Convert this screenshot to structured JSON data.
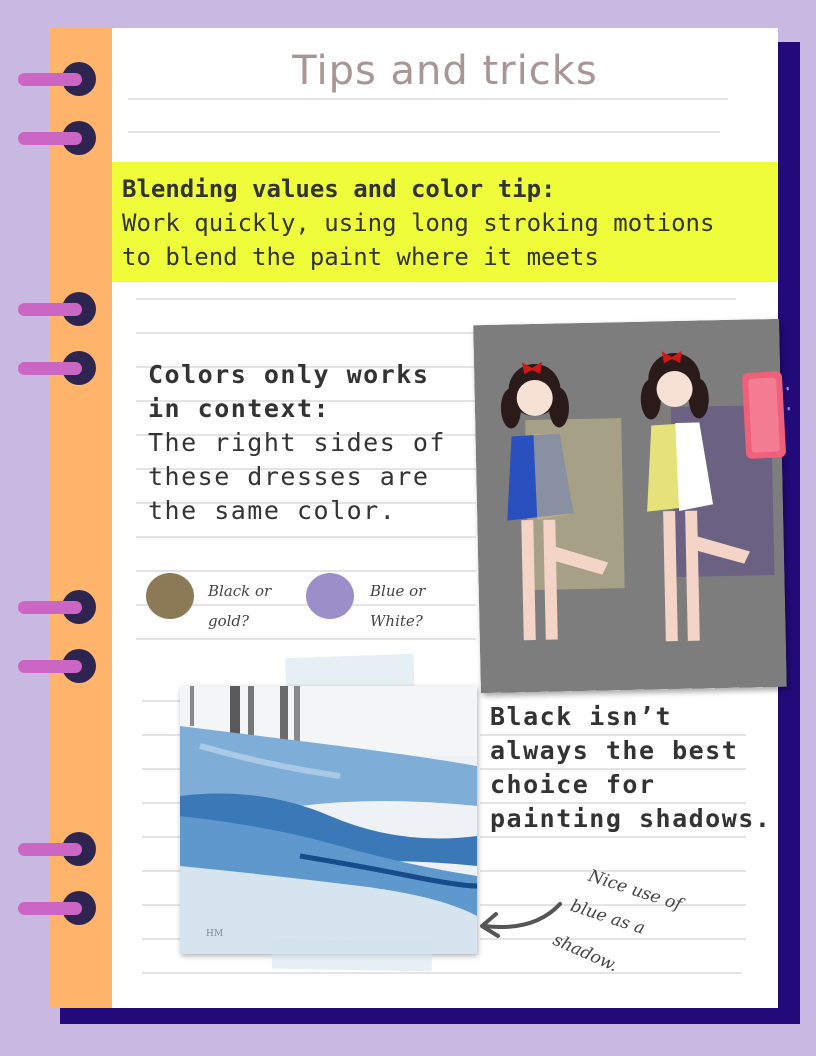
{
  "colors": {
    "background": "#c9b8e2",
    "back_page": "#230a7a",
    "spine": "#ffb46b",
    "ring_bar": "#cc66c4",
    "ring_hole": "#2e2450",
    "title": "#a89595",
    "highlight": "#eefc3a",
    "rule": "#e4e4e8",
    "swatch_gold": "#8c7955",
    "swatch_blue": "#9b8fca",
    "clip": "#f0607a",
    "text": "#333333"
  },
  "page": {
    "title": "Tips and tricks"
  },
  "tip": {
    "heading": "Blending values and color tip:",
    "line1": "Work quickly, using long stroking motions",
    "line2": "to blend the paint where it meets"
  },
  "context": {
    "heading_line1": "Colors only works",
    "heading_line2": "in context:",
    "body_line1": "The right sides of",
    "body_line2": "these dresses are",
    "body_line3": "the same color."
  },
  "swatches": [
    {
      "label_line1": "Black or",
      "label_line2": "gold?",
      "color": "#8c7955"
    },
    {
      "label_line1": "Blue or",
      "label_line2": "White?",
      "color": "#9b8fca"
    }
  ],
  "shadow_note": {
    "line1": "Black isn’t",
    "line2": "always the best",
    "line3": "choice for",
    "line4": "painting shadows."
  },
  "annotation": {
    "line1": "Nice use of",
    "line2": "blue as a",
    "line3": "shadow."
  },
  "painting_signature": "HM"
}
